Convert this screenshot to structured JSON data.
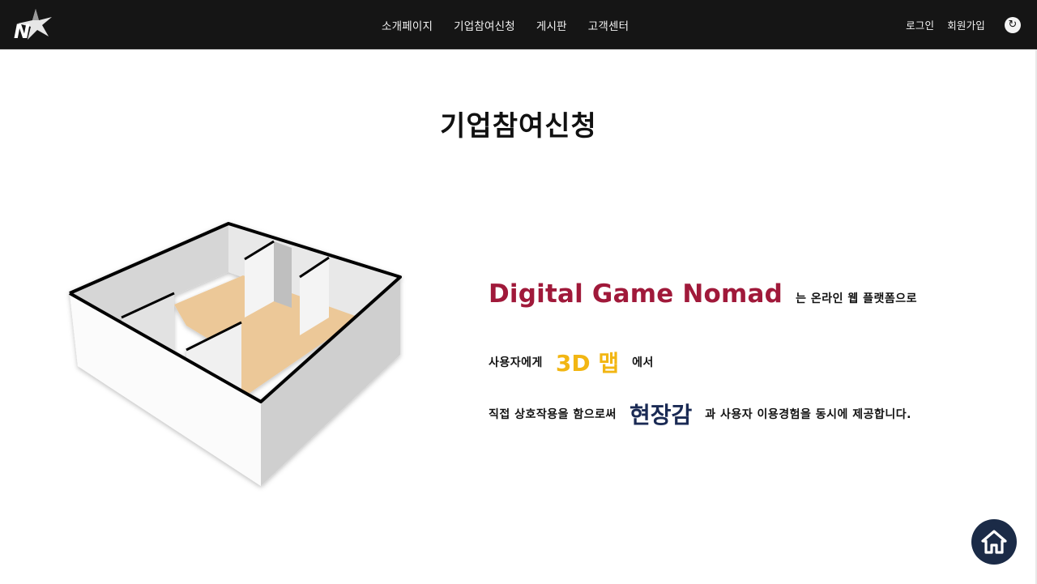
{
  "nav": {
    "links": [
      "소개페이지",
      "기업참여신청",
      "게시판",
      "고객센터"
    ],
    "login": "로그인",
    "signup": "회원가입",
    "refresh_icon": "↻"
  },
  "page": {
    "title": "기업참여신청"
  },
  "intro": {
    "brand": "Digital Game Nomad",
    "line1_suffix": "는 온라인 웹 플랫폼으로",
    "line2_prefix": "사용자에게",
    "map_highlight": "3D 맵",
    "line2_suffix": "에서",
    "line3_prefix": "직접 상호작용을 함으로써",
    "presence_highlight": "현장감",
    "line3_suffix": "과 사용자 이용경험을 동시에 제공합니다."
  },
  "colors": {
    "navbar": "#151515",
    "brand": "#a0193a",
    "map_highlight": "#f2b613",
    "presence_highlight": "#1a2a54",
    "home_button": "#1b2b47",
    "floor": "#ecc898"
  },
  "icons": {
    "logo": "n-star-logo",
    "refresh": "refresh-icon",
    "home": "home-icon"
  }
}
